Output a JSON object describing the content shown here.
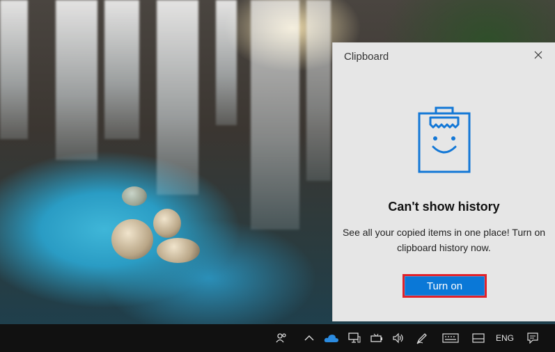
{
  "flyout": {
    "title": "Clipboard",
    "heading": "Can't show history",
    "description": "See all your copied items in one place! Turn on clipboard history now.",
    "turn_on_label": "Turn on",
    "accent_color": "#0a78d7",
    "highlight_color": "#e0222a"
  },
  "taskbar": {
    "language": "ENG",
    "icons": [
      "people-icon",
      "chevron-up-icon",
      "onedrive-icon",
      "network-icon",
      "battery-icon",
      "volume-icon",
      "pen-icon",
      "touch-keyboard-icon",
      "tablet-mode-icon",
      "notifications-icon"
    ]
  }
}
